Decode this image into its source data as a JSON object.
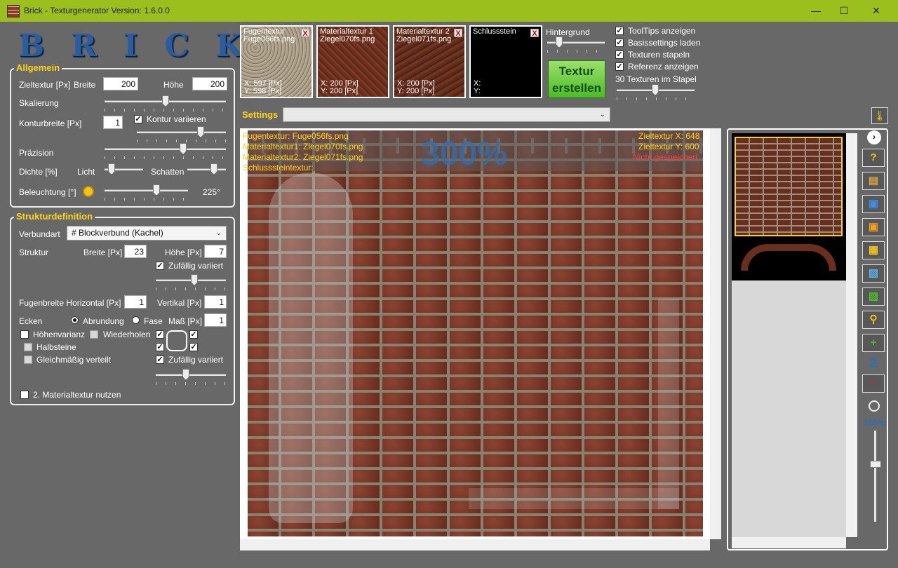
{
  "window": {
    "title": "Brick - Texturgenerator   Version: 1.6.0.0",
    "minimize": "—",
    "maximize": "☐",
    "close": "✕"
  },
  "logo": "BRICK",
  "allgemein": {
    "title": "Allgemein",
    "zieltextur_label": "Zieltextur [Px]",
    "breite_label": "Breite",
    "breite_value": "200",
    "hoehe_label": "Höhe",
    "hoehe_value": "200",
    "skalierung_label": "Skalierung",
    "kontur_label": "Konturbreite [Px]",
    "kontur_value": "1",
    "kontur_variieren": "Kontur variieren",
    "praezision_label": "Präzision",
    "dichte_label": "Dichte [%]",
    "licht_label": "Licht",
    "schatten_label": "Schatten",
    "beleuchtung_label": "Beleuchtung [°]",
    "beleuchtung_value": "225°"
  },
  "struktur": {
    "title": "Strukturdefinition",
    "verbundart_label": "Verbundart",
    "verbundart_value": "# Blockverbund (Kachel)",
    "struktur_label": "Struktur",
    "breite_label": "Breite [Px]",
    "breite_value": "23",
    "hoehe_label": "Höhe [Px]",
    "hoehe_value": "7",
    "zufaellig": "Zufällig variiert",
    "fugen_h_label": "Fugenbreite Horizontal [Px]",
    "fugen_h_value": "1",
    "vertikal_label": "Vertikal [Px]",
    "vertikal_value": "1",
    "ecken_label": "Ecken",
    "abrundung": "Abrundung",
    "fase": "Fase",
    "mass_label": "Maß [Px]",
    "mass_value": "1",
    "hoehenvarianz": "Höhenvarianz",
    "wiederholen": "Wiederholen",
    "halbsteine": "Halbsteine",
    "gleichmaessig": "Gleichmäßig verteilt",
    "zufaellig2": "Zufällig variiert",
    "material2": "2. Materialtextur nutzen"
  },
  "tiles": [
    {
      "label": "Fugentextur",
      "file": "Fuge056fs.png",
      "x": "X: 597 [Px]",
      "y": "Y: 598 [Px]",
      "close": "X"
    },
    {
      "label": "Materialtextur 1",
      "file": "Ziegel070fs.png",
      "x": "X: 200 [Px]",
      "y": "Y: 200 [Px]",
      "close": "X"
    },
    {
      "label": "Materialtextur 2",
      "file": "Ziegel071fs.png",
      "x": "X: 200 [Px]",
      "y": "Y: 200 [Px]",
      "close": "X"
    },
    {
      "label": "Schlussstein",
      "file": "",
      "x": "X:",
      "y": "Y:",
      "close": "X"
    }
  ],
  "hintergrund_label": "Hintergrund",
  "create_button": {
    "line1": "Textur",
    "line2": "erstellen"
  },
  "options": {
    "tooltips": "ToolTips anzeigen",
    "basissettings": "Basissettings laden",
    "stapeln": "Texturen stapeln",
    "referenz": "Referenz anzeigen",
    "stapel_count": "30 Texturen im Stapel"
  },
  "settings": {
    "label": "Settings",
    "value": ""
  },
  "overlay": {
    "fugentextur": "Fugentextur: Fuge056fs.png",
    "material1": "Materialtextur1: Ziegel070fs.png",
    "material2": "Materialtextur2: Ziegel071fs.png",
    "schluss": "Schlusssteintextur:",
    "zoom": "300%",
    "ziel_x": "Zieltextur X: 648",
    "ziel_y": "Zieltextur Y: 600",
    "status": "Nicht gespeichert"
  },
  "sidebar": {
    "count": "2",
    "zoom": "100%"
  },
  "colors": {
    "accent": "#9bc01e",
    "title_yellow": "#ffd21a",
    "status_red": "#ff4040",
    "zoom_blue": "#2b6fb5"
  }
}
